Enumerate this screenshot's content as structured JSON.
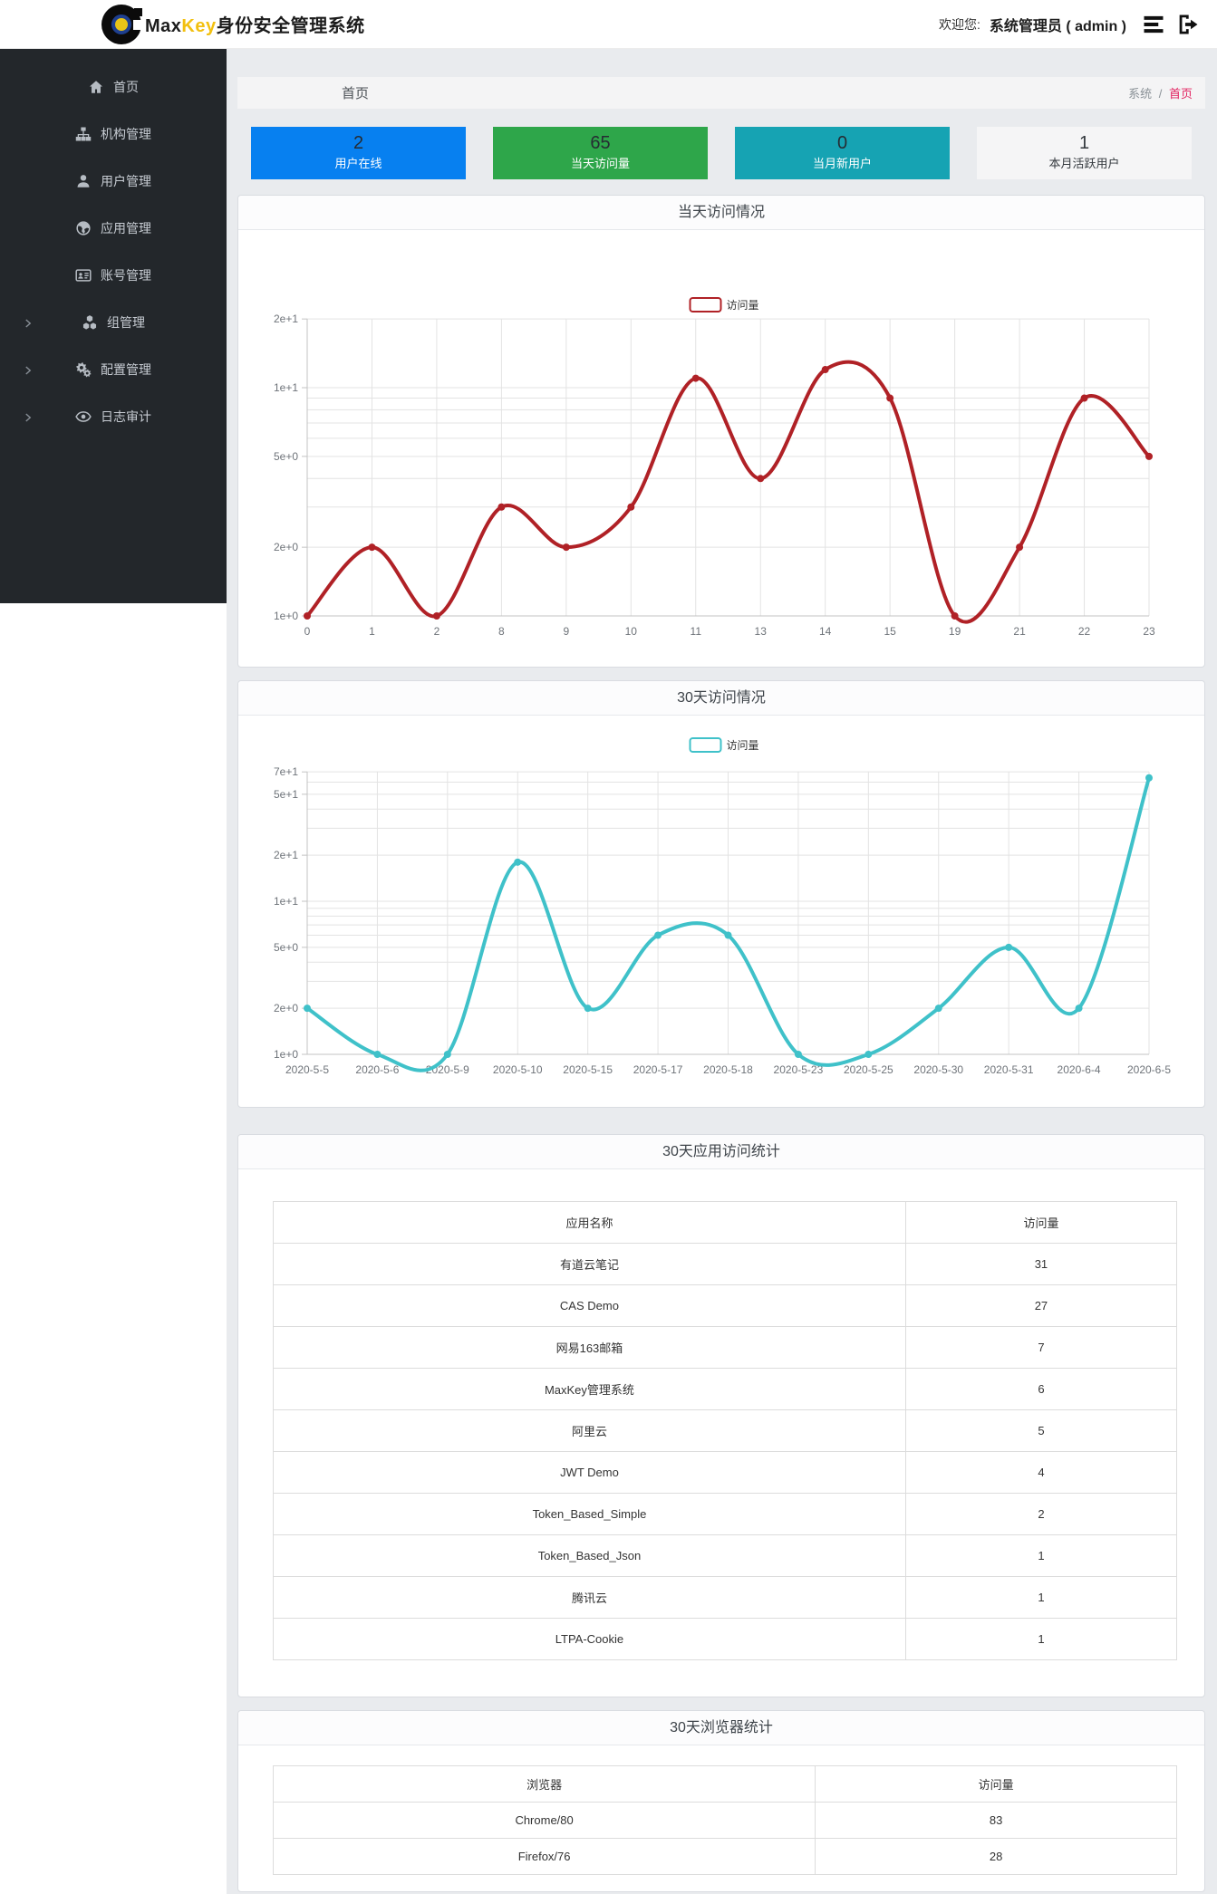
{
  "header": {
    "logo_max": "Max",
    "logo_key": "Key",
    "logo_suffix": "身份安全管理系统",
    "welcome_label": "欢迎您:",
    "user": "系统管理员 ( admin )"
  },
  "sidebar": {
    "items": [
      {
        "label": "首页",
        "icon": "home-icon",
        "arrow": false
      },
      {
        "label": "机构管理",
        "icon": "sitemap-icon",
        "arrow": false
      },
      {
        "label": "用户管理",
        "icon": "user-icon",
        "arrow": false
      },
      {
        "label": "应用管理",
        "icon": "globe-icon",
        "arrow": false
      },
      {
        "label": "账号管理",
        "icon": "id-card-icon",
        "arrow": false
      },
      {
        "label": "组管理",
        "icon": "cubes-icon",
        "arrow": true
      },
      {
        "label": "配置管理",
        "icon": "gears-icon",
        "arrow": true
      },
      {
        "label": "日志审计",
        "icon": "eye-icon",
        "arrow": true
      }
    ]
  },
  "breadcrumb": {
    "page_title": "首页",
    "root": "系统",
    "separator": "/",
    "current": "首页"
  },
  "stats": [
    {
      "value": "2",
      "label": "用户在线",
      "bg": "#0780f0",
      "value_color": "#262c33",
      "label_color": "#ffffff"
    },
    {
      "value": "65",
      "label": "当天访问量",
      "bg": "#2ea64a",
      "value_color": "#262c33",
      "label_color": "#ffffff"
    },
    {
      "value": "0",
      "label": "当月新用户",
      "bg": "#16a3b3",
      "value_color": "#262c33",
      "label_color": "#ffffff"
    },
    {
      "value": "1",
      "label": "本月活跃用户",
      "bg": "#f5f5f6",
      "value_color": "#33383d",
      "label_color": "#33383d"
    }
  ],
  "chart_data": [
    {
      "type": "line",
      "title": "当天访问情况",
      "legend": "访问量",
      "color": "#b02126",
      "smooth": true,
      "yscale": "log",
      "categories": [
        "0",
        "1",
        "2",
        "8",
        "9",
        "10",
        "11",
        "13",
        "14",
        "15",
        "19",
        "21",
        "22",
        "23"
      ],
      "values": [
        1,
        2,
        1,
        3,
        2,
        3,
        11,
        4,
        12,
        9,
        1,
        2,
        9,
        5
      ],
      "ylim": [
        1,
        20
      ],
      "ytick_values": [
        1,
        2,
        5,
        10,
        20
      ],
      "ytick_labels": [
        "1e+0",
        "2e+0",
        "5e+0",
        "1e+1",
        "2e+1"
      ],
      "grid_values": [
        2,
        3,
        4,
        5,
        6,
        7,
        8,
        9,
        10,
        20
      ],
      "xlabel": "",
      "ylabel": "",
      "legend_position": "top-center",
      "grid": true
    },
    {
      "type": "line",
      "title": "30天访问情况",
      "legend": "访问量",
      "color": "#3fc1c9",
      "smooth": true,
      "yscale": "log",
      "categories": [
        "2020-5-5",
        "2020-5-6",
        "2020-5-9",
        "2020-5-10",
        "2020-5-15",
        "2020-5-17",
        "2020-5-18",
        "2020-5-23",
        "2020-5-25",
        "2020-5-30",
        "2020-5-31",
        "2020-6-4",
        "2020-6-5"
      ],
      "values": [
        2,
        1,
        1,
        18,
        2,
        6,
        6,
        1,
        1,
        2,
        5,
        2,
        64
      ],
      "ylim": [
        1,
        70
      ],
      "ytick_values": [
        1,
        2,
        5,
        10,
        20,
        50,
        70
      ],
      "ytick_labels": [
        "1e+0",
        "2e+0",
        "5e+0",
        "1e+1",
        "2e+1",
        "5e+1",
        "7e+1"
      ],
      "grid_values": [
        2,
        3,
        4,
        5,
        6,
        7,
        8,
        9,
        10,
        20,
        30,
        40,
        50,
        60,
        70
      ],
      "xlabel": "",
      "ylabel": "",
      "legend_position": "top-center",
      "grid": true
    },
    {
      "type": "table",
      "title": "30天应用访问统计",
      "headers": [
        "应用名称",
        "访问量"
      ],
      "rows": [
        [
          "有道云笔记",
          "31"
        ],
        [
          "CAS Demo",
          "27"
        ],
        [
          "网易163邮箱",
          "7"
        ],
        [
          "MaxKey管理系统",
          "6"
        ],
        [
          "阿里云",
          "5"
        ],
        [
          "JWT Demo",
          "4"
        ],
        [
          "Token_Based_Simple",
          "2"
        ],
        [
          "Token_Based_Json",
          "1"
        ],
        [
          "腾讯云",
          "1"
        ],
        [
          "LTPA-Cookie",
          "1"
        ]
      ]
    },
    {
      "type": "table",
      "title": "30天浏览器统计",
      "headers": [
        "浏览器",
        "访问量"
      ],
      "rows": [
        [
          "Chrome/80",
          "83"
        ],
        [
          "Firefox/76",
          "28"
        ]
      ]
    }
  ]
}
